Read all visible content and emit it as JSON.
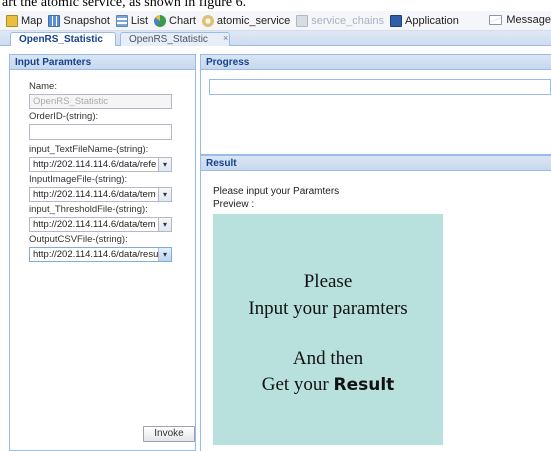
{
  "caption": "art the atomic service, as shown in figure 6.",
  "toolbar": {
    "items": [
      {
        "label": "Map",
        "icon": "map-icon",
        "color": "#e8c040"
      },
      {
        "label": "Snapshot",
        "icon": "grid-icon",
        "color": "#5a8fd0"
      },
      {
        "label": "List",
        "icon": "list-icon",
        "color": "#7aa6d8"
      },
      {
        "label": "Chart",
        "icon": "pie-chart-icon",
        "color": "#3a9a4a"
      },
      {
        "label": "atomic_service",
        "icon": "atom-icon",
        "color": "#e0c070"
      },
      {
        "label": "service_chains",
        "icon": "chain-icon",
        "color": "#b0b8c4"
      },
      {
        "label": "Application",
        "icon": "app-icon",
        "color": "#2f5fa8"
      }
    ],
    "message_label": "Message",
    "message_icon": "envelope-icon"
  },
  "tabs": [
    {
      "label": "OpenRS_Statistic",
      "active": true
    },
    {
      "label": "OpenRS_Statistic",
      "active": false
    }
  ],
  "tab_close_symbol": "×",
  "input_panel": {
    "title": "Input Paramters",
    "fields": [
      {
        "label": "Name:",
        "value": "OpenRS_Statistic",
        "kind": "text-disabled"
      },
      {
        "label": "OrderID-(string):",
        "value": "",
        "kind": "text"
      },
      {
        "label": "input_TextFileName-(string):",
        "value": "http://202.114.114.6/data/refe",
        "kind": "combo"
      },
      {
        "label": "InputImageFile-(string):",
        "value": "http://202.114.114.6/data/tem",
        "kind": "combo"
      },
      {
        "label": "input_ThresholdFile-(string):",
        "value": "http://202.114.114.6/data/tem",
        "kind": "combo"
      },
      {
        "label": "OutputCSVFile-(string):",
        "value": "http://202.114.114.6/data/resu",
        "kind": "combo-focus"
      }
    ],
    "invoke_label": "Invoke"
  },
  "progress_panel": {
    "title": "Progress",
    "progress": 0
  },
  "result_panel": {
    "title": "Result",
    "message": "Please input your Paramters",
    "preview_label": "Preview :",
    "preview": {
      "line1": "Please",
      "line2": "Input your paramters",
      "line3": "And then",
      "line4_prefix": "Get your ",
      "line4_bold": "Result",
      "background": "#b8e0dc"
    }
  }
}
